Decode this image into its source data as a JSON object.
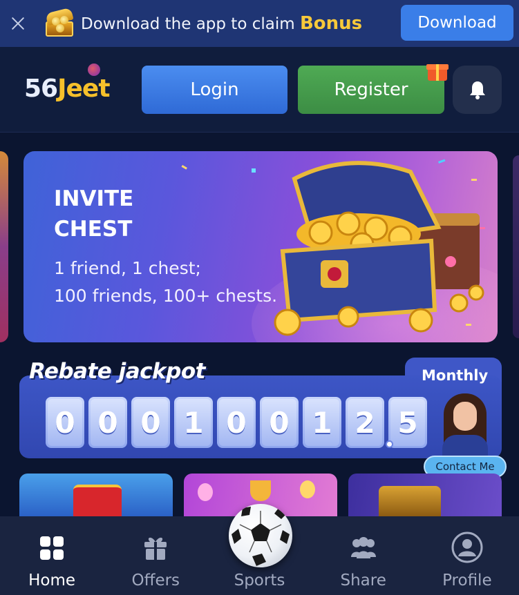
{
  "app_banner": {
    "message": "Download the app to claim",
    "highlight": "Bonus",
    "download_label": "Download"
  },
  "header": {
    "logo_number": "56",
    "logo_word": "Jeet",
    "login_label": "Login",
    "register_label": "Register"
  },
  "promo": {
    "title": "INVITE\nCHEST",
    "subtitle": "1 friend, 1 chest;\n100 friends, 100+ chests."
  },
  "jackpot": {
    "title": "Rebate jackpot",
    "period": "Monthly",
    "digits": [
      "0",
      "0",
      "0",
      "1",
      "0",
      "0",
      "1",
      "2",
      "5"
    ],
    "contact_label": "Contact Me"
  },
  "bottom_nav": {
    "items": [
      {
        "label": "Home",
        "icon": "home-grid-icon"
      },
      {
        "label": "Offers",
        "icon": "gift-icon"
      },
      {
        "label": "Sports",
        "icon": "soccer-ball-icon"
      },
      {
        "label": "Share",
        "icon": "people-icon"
      },
      {
        "label": "Profile",
        "icon": "user-icon"
      }
    ]
  },
  "colors": {
    "accent_blue": "#3a7ee8",
    "register_green": "#4faa54",
    "bonus_gold": "#f7c93a",
    "background": "#0b1530"
  }
}
